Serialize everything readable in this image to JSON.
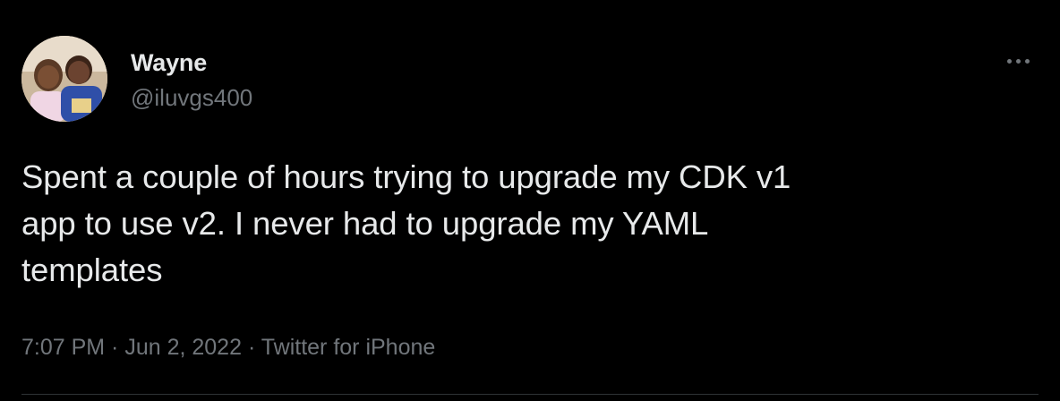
{
  "tweet": {
    "author": {
      "display_name": "Wayne",
      "handle": "@iluvgs400",
      "avatar_icon": "profile-photo-avatar"
    },
    "more_icon": "more-options-icon",
    "text": "Spent a couple of hours trying to upgrade my CDK v1\napp to use v2. I never had to upgrade my YAML\ntemplates",
    "time": "7:07 PM",
    "separator": " · ",
    "date": "Jun 2, 2022",
    "source": "Twitter for iPhone"
  },
  "colors": {
    "background": "#000000",
    "primary_text": "#e7e9ea",
    "secondary_text": "#71767b",
    "divider": "#2f3336"
  }
}
